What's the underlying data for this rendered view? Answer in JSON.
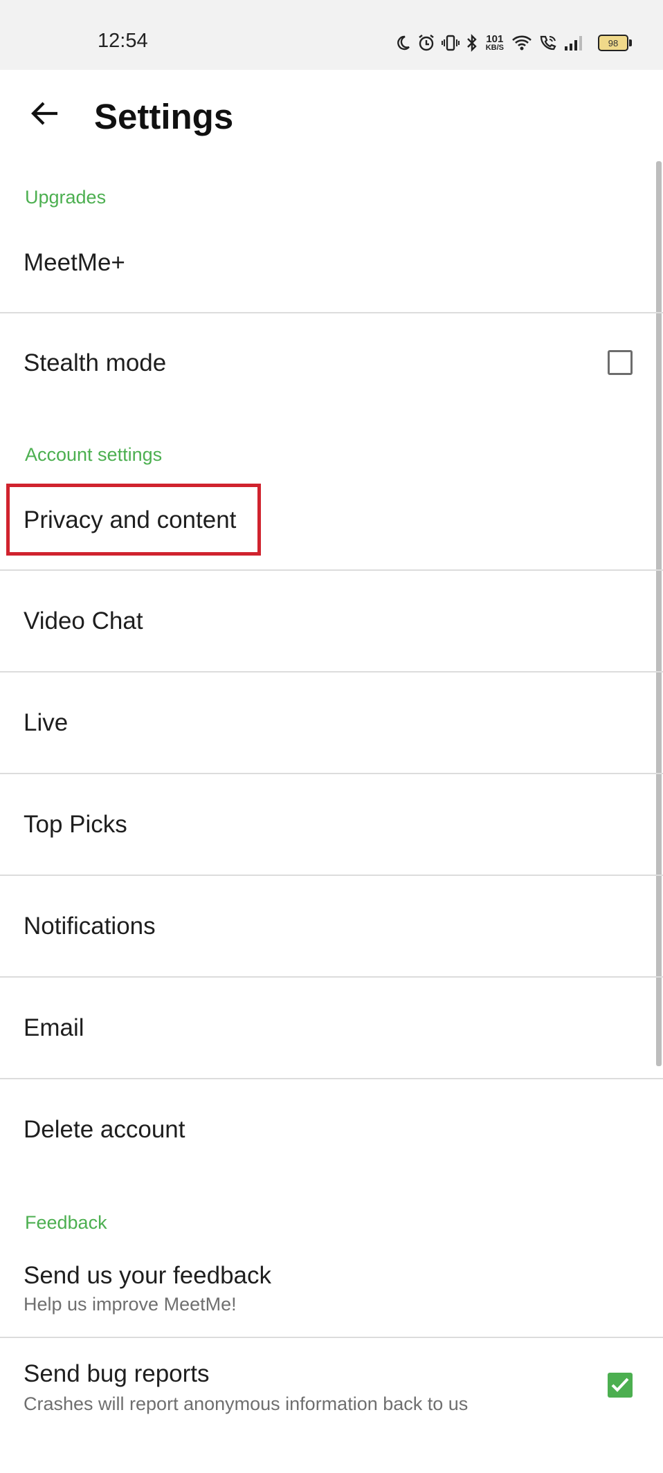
{
  "status_bar": {
    "time": "12:54",
    "network_speed_value": "101",
    "network_speed_unit": "KB/S",
    "battery_level": "98",
    "icons": [
      "moon-icon",
      "alarm-icon",
      "vibrate-icon",
      "bluetooth-icon",
      "wifi-icon",
      "wifi-calling-icon",
      "signal-icon",
      "battery-icon"
    ]
  },
  "app_bar": {
    "title": "Settings",
    "back_icon": "arrow-left-icon"
  },
  "sections": {
    "upgrades": {
      "header": "Upgrades",
      "meetme_plus": "MeetMe+",
      "stealth_mode": "Stealth mode",
      "stealth_mode_checked": false
    },
    "account": {
      "header": "Account settings",
      "privacy": "Privacy and content",
      "video_chat": "Video Chat",
      "live": "Live",
      "top_picks": "Top Picks",
      "notifications": "Notifications",
      "email": "Email",
      "delete_account": "Delete account"
    },
    "feedback": {
      "header": "Feedback",
      "send_feedback": "Send us your feedback",
      "send_feedback_sub": "Help us improve MeetMe!",
      "bug_reports": "Send bug reports",
      "bug_reports_sub": "Crashes will report anonymous information back to us",
      "bug_reports_checked": true
    }
  },
  "colors": {
    "accent": "#4caf50",
    "highlight": "#d0232e",
    "divider": "#dcdcdc"
  }
}
